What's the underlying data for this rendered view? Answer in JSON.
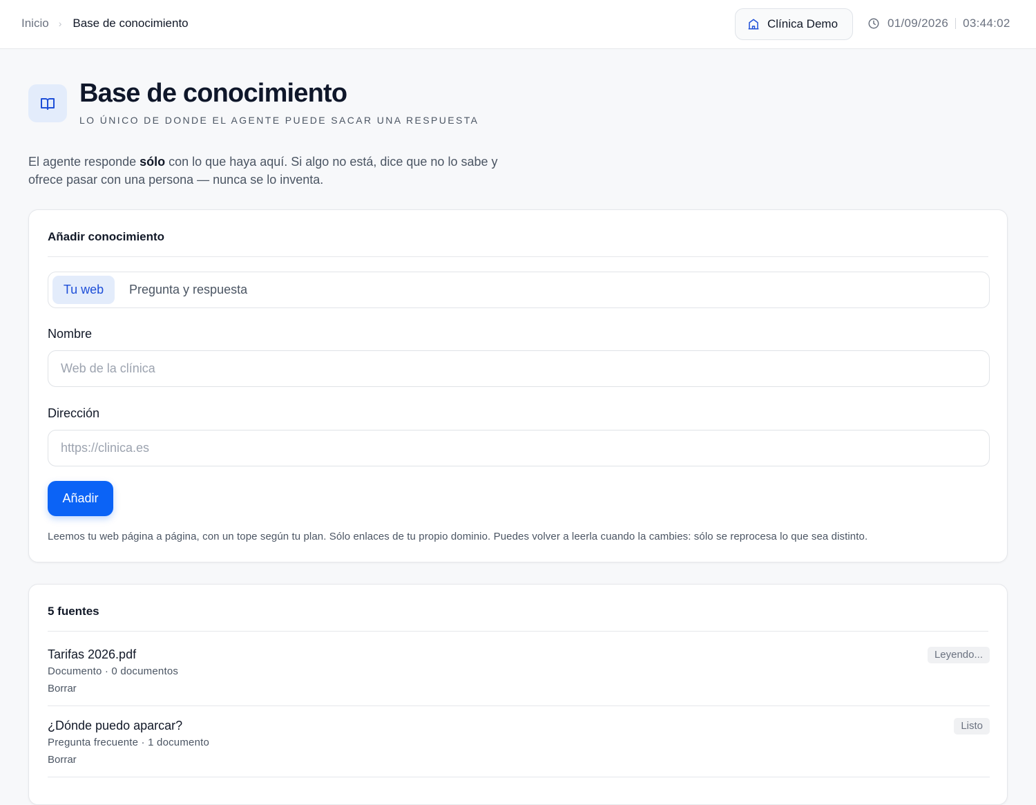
{
  "header": {
    "breadcrumb_home": "Inicio",
    "breadcrumb_separator": "›",
    "breadcrumb_current": "Base de conocimiento",
    "clinic_name": "Clínica Demo",
    "date": "01/09/2026",
    "time": "03:44:02"
  },
  "page": {
    "title": "Base de conocimiento",
    "subtitle": "LO ÚNICO DE DONDE EL AGENTE PUEDE SACAR UNA RESPUESTA",
    "intro_before": "El agente responde ",
    "intro_bold": "sólo",
    "intro_after": " con lo que haya aquí. Si algo no está, dice que no lo sabe y ofrece pasar con una persona — nunca se lo inventa."
  },
  "add_card": {
    "title": "Añadir conocimiento",
    "tabs": [
      {
        "label": "Tu web",
        "active": true
      },
      {
        "label": "Pregunta y respuesta",
        "active": false
      }
    ],
    "name_label": "Nombre",
    "name_placeholder": "Web de la clínica",
    "name_value": "",
    "address_label": "Dirección",
    "address_placeholder": "https://clinica.es",
    "address_value": "",
    "submit_label": "Añadir",
    "help_text": "Leemos tu web página a página, con un tope según tu plan. Sólo enlaces de tu propio dominio. Puedes volver a leerla cuando la cambies: sólo se reprocesa lo que sea distinto."
  },
  "sources_card": {
    "title": "5 fuentes",
    "items": [
      {
        "name": "Tarifas 2026.pdf",
        "meta": "Documento · 0 documentos",
        "delete_label": "Borrar",
        "status": "Leyendo..."
      },
      {
        "name": "¿Dónde puedo aparcar?",
        "meta": "Pregunta frecuente · 1 documento",
        "delete_label": "Borrar",
        "status": "Listo"
      }
    ]
  },
  "colors": {
    "accent": "#0b63f6",
    "accent_soft": "#e3ecfb",
    "accent_text": "#1d4ed8",
    "page_bg": "#f7f8fa"
  },
  "icons": {
    "clinic": "building-icon",
    "clock": "clock-icon",
    "page": "book-open-icon"
  }
}
